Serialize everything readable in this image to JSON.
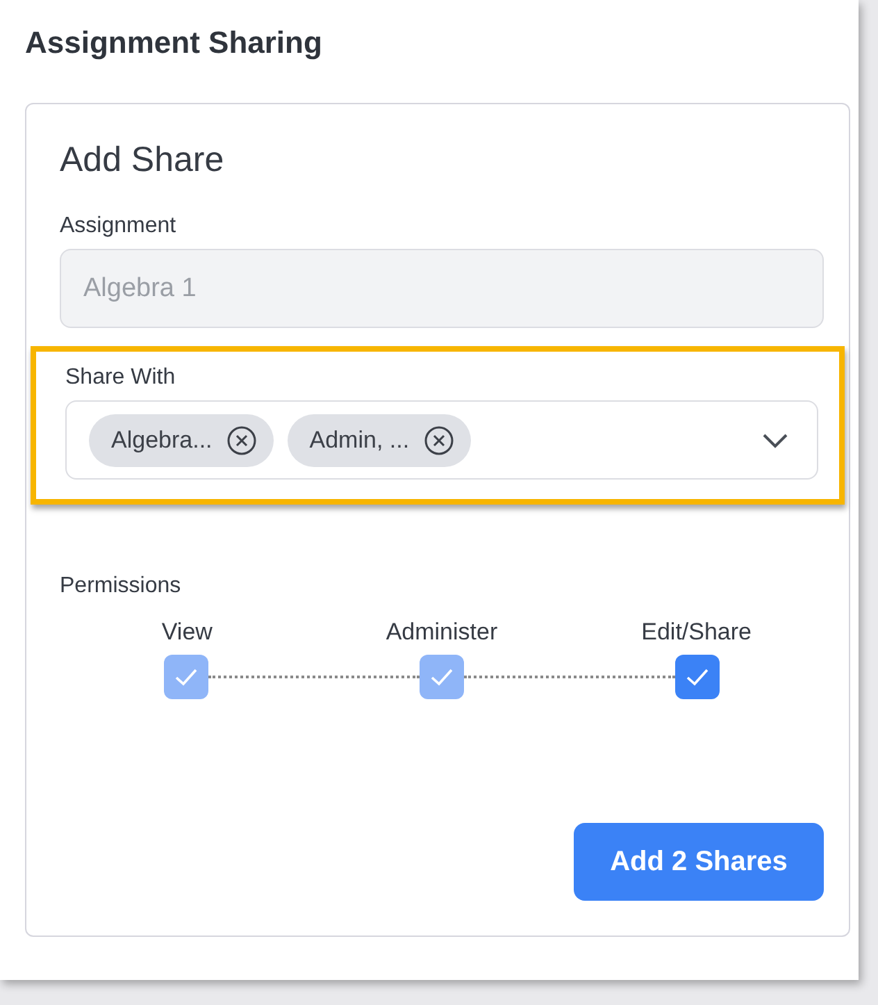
{
  "page": {
    "title": "Assignment Sharing"
  },
  "card": {
    "title": "Add Share",
    "assignment": {
      "label": "Assignment",
      "value": "Algebra 1",
      "disabled": true
    },
    "share_with": {
      "label": "Share With",
      "highlighted": true,
      "chips": [
        {
          "label": "Algebra..."
        },
        {
          "label": "Admin, ..."
        }
      ]
    },
    "permissions": {
      "label": "Permissions",
      "items": [
        {
          "label": "View",
          "checked": true,
          "disabled": true
        },
        {
          "label": "Administer",
          "checked": true,
          "disabled": true
        },
        {
          "label": "Edit/Share",
          "checked": true,
          "disabled": false
        }
      ]
    },
    "submit": {
      "label": "Add 2 Shares"
    }
  }
}
